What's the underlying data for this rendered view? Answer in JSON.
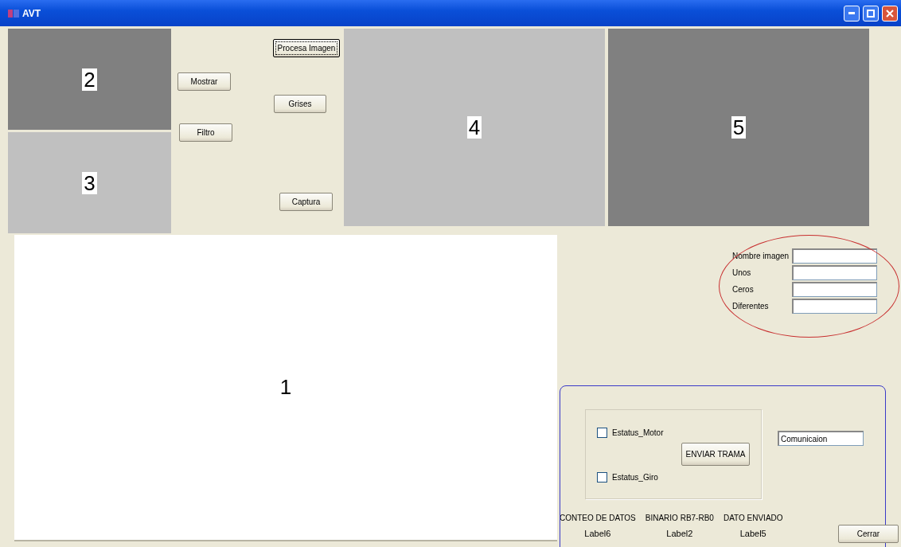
{
  "window": {
    "title": "AVT"
  },
  "image_panels": [
    {
      "label": "2",
      "color": "#808080"
    },
    {
      "label": "3",
      "color": "#c0c0c0"
    },
    {
      "label": "4",
      "color": "#c0c0c0"
    },
    {
      "label": "5",
      "color": "#808080"
    }
  ],
  "buttons": [
    {
      "label": "Procesa Imagen",
      "focused": true
    },
    {
      "label": "Mostrar",
      "focused": false
    },
    {
      "label": "Grises",
      "focused": false
    },
    {
      "label": "Filtro",
      "focused": false
    },
    {
      "label": "Captura",
      "focused": false
    }
  ],
  "main_panel": {
    "label": "1"
  },
  "fields": [
    {
      "label": "Nombre imagen"
    },
    {
      "label": "Unos"
    },
    {
      "label": "Ceros"
    },
    {
      "label": "Diferentes"
    }
  ],
  "communication": {
    "checkboxes": [
      {
        "label": "Estatus_Motor",
        "checked": false
      },
      {
        "label": "Estatus_Giro",
        "checked": false
      }
    ],
    "send_button": "ENVIAR TRAMA",
    "status_field": "Comunicaion",
    "columns": [
      {
        "heading": "CONTEO DE DATOS",
        "value": "Label6"
      },
      {
        "heading": "BINARIO RB7-RB0",
        "value": "Label2"
      },
      {
        "heading": "DATO ENVIADO",
        "value": "Label5"
      }
    ]
  },
  "close_button": "Cerrar",
  "annotations": [
    {
      "kind": "ellipse",
      "color": "#c83030"
    },
    {
      "kind": "frame",
      "color": "#3a3ac8"
    }
  ]
}
